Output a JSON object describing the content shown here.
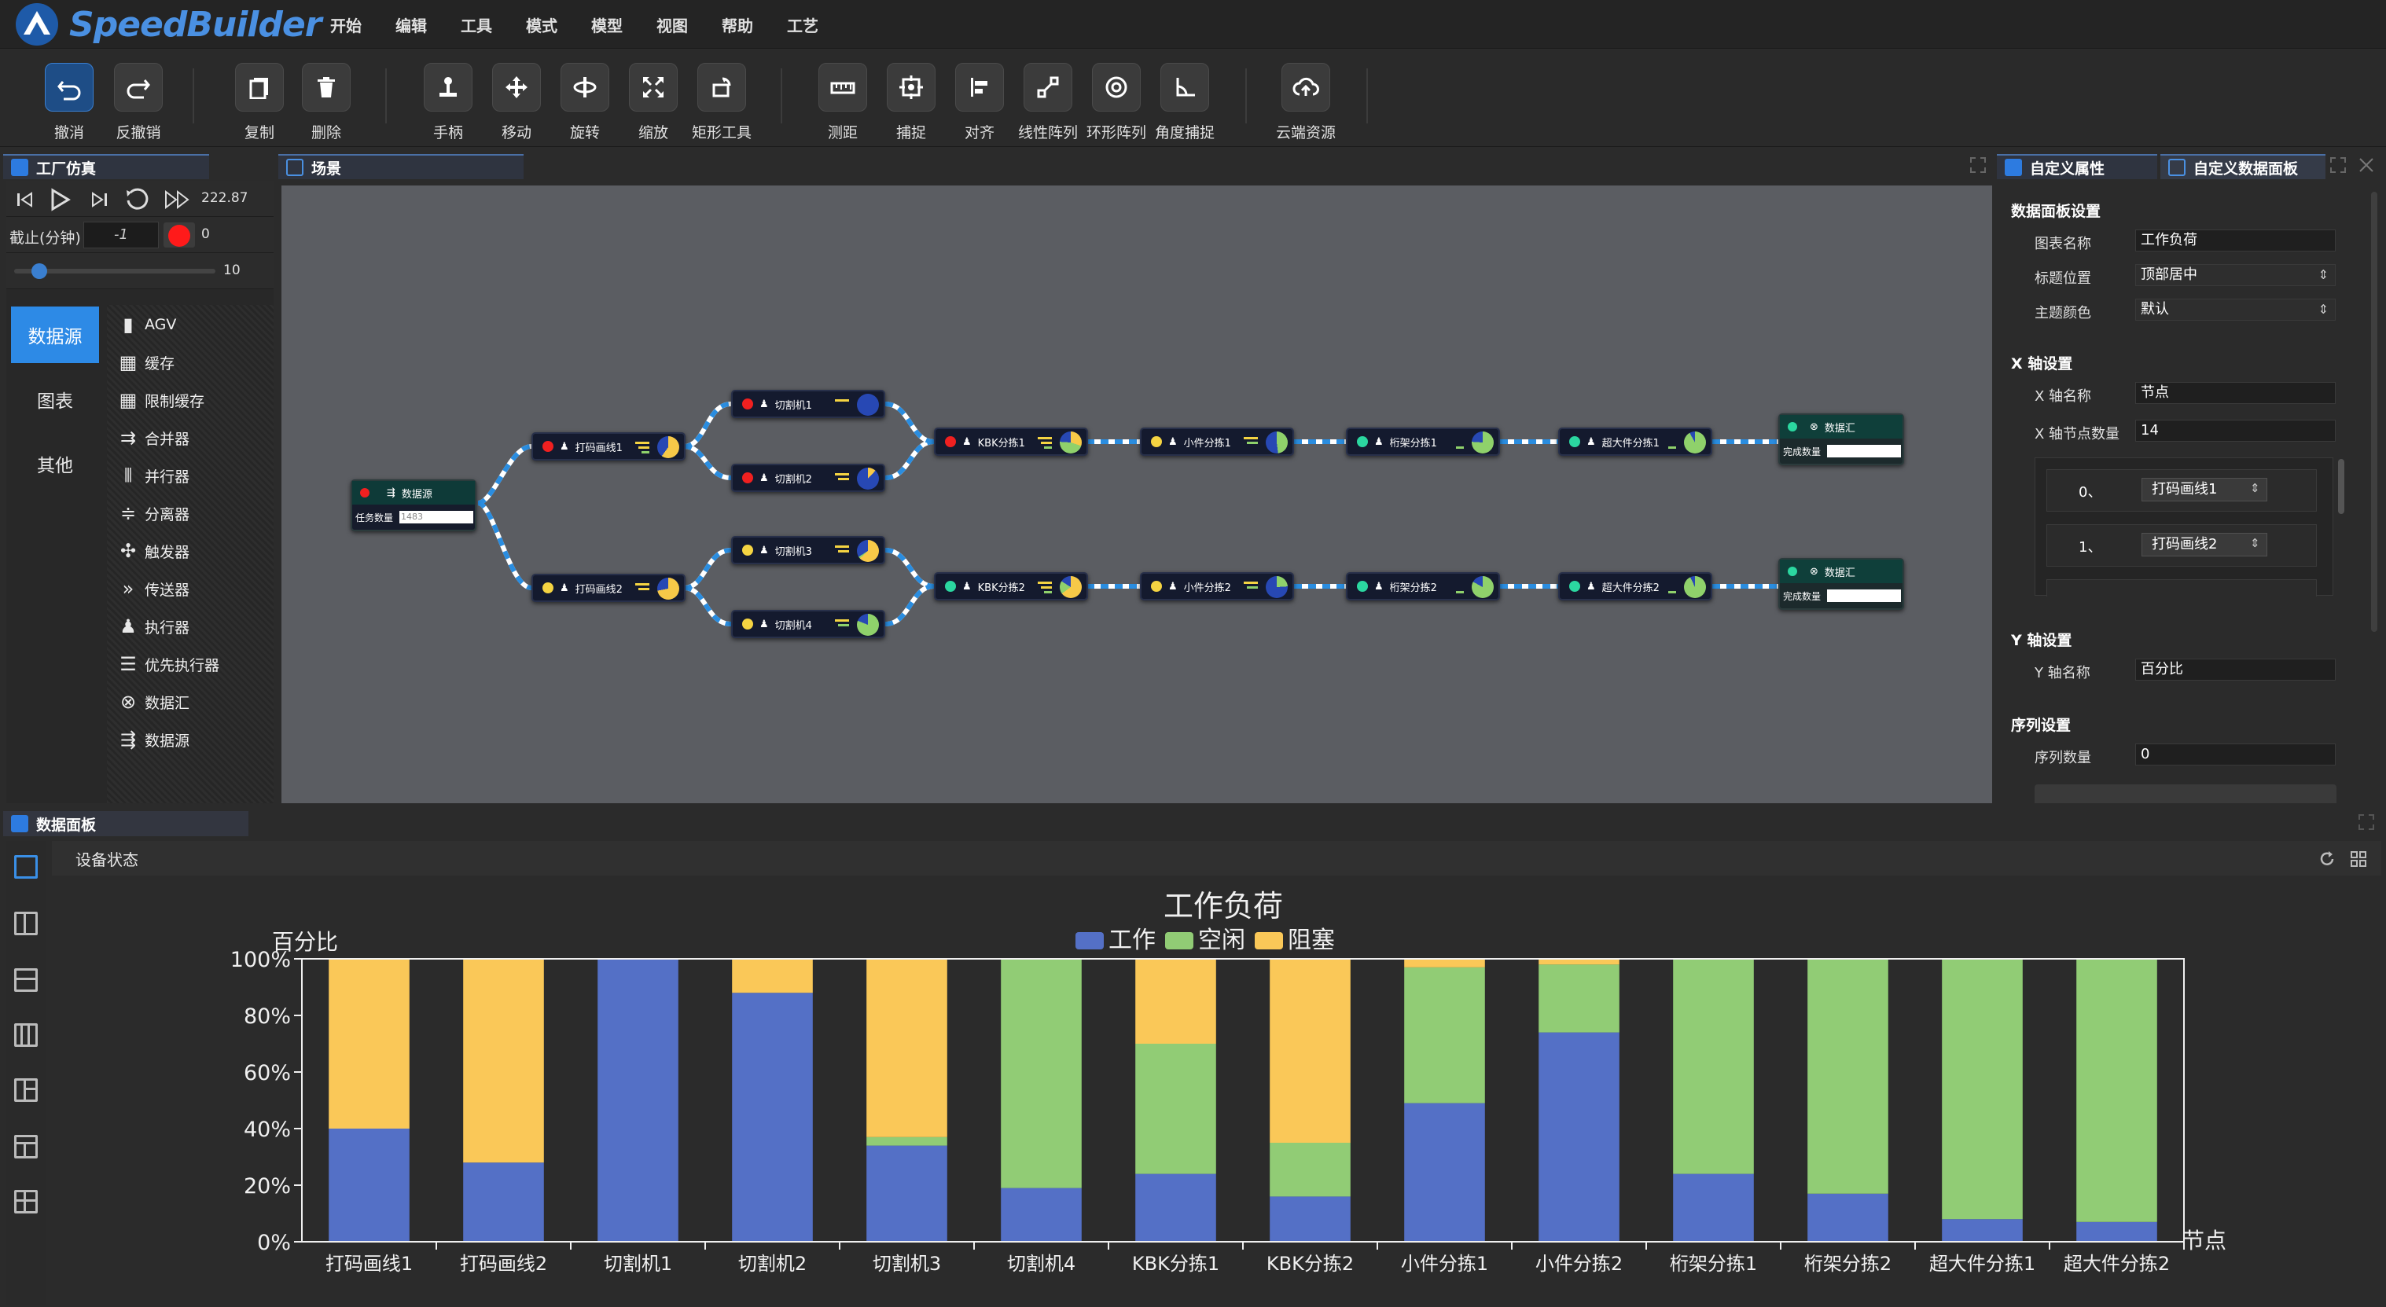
{
  "app": {
    "name": "SpeedBuilder"
  },
  "menu": [
    "开始",
    "编辑",
    "工具",
    "模式",
    "模型",
    "视图",
    "帮助",
    "工艺"
  ],
  "toolbar": [
    {
      "label": "撤消",
      "icon": "undo-icon"
    },
    {
      "label": "反撤销",
      "icon": "redo-icon"
    },
    {
      "label": "复制",
      "icon": "copy-icon"
    },
    {
      "label": "删除",
      "icon": "delete-icon"
    },
    {
      "label": "手柄",
      "icon": "handle-icon"
    },
    {
      "label": "移动",
      "icon": "move-icon"
    },
    {
      "label": "旋转",
      "icon": "rotate-icon"
    },
    {
      "label": "缩放",
      "icon": "scale-icon"
    },
    {
      "label": "矩形工具",
      "icon": "rect-tool-icon"
    },
    {
      "label": "测距",
      "icon": "ruler-icon"
    },
    {
      "label": "捕捉",
      "icon": "snap-icon"
    },
    {
      "label": "对齐",
      "icon": "align-icon"
    },
    {
      "label": "线性阵列",
      "icon": "linear-array-icon"
    },
    {
      "label": "环形阵列",
      "icon": "circular-array-icon"
    },
    {
      "label": "角度捕捉",
      "icon": "angle-snap-icon"
    },
    {
      "label": "云端资源",
      "icon": "cloud-icon"
    }
  ],
  "factory": {
    "title": "工厂仿真",
    "time": "222.87",
    "stop_label": "截止(分钟)",
    "stop_value": "-1",
    "record_count": "0",
    "speed_value": "10",
    "categories": [
      "数据源",
      "图表",
      "其他"
    ],
    "library": [
      "AGV",
      "缓存",
      "限制缓存",
      "合并器",
      "并行器",
      "分离器",
      "触发器",
      "传送器",
      "执行器",
      "优先执行器",
      "数据汇",
      "数据源"
    ]
  },
  "scene": {
    "title": "场景",
    "source": {
      "name": "数据源",
      "field_label": "任务数量",
      "field_value": "1483"
    },
    "nodes": [
      "打码画线1",
      "打码画线2",
      "切割机1",
      "切割机2",
      "切割机3",
      "切割机4",
      "KBK分拣1",
      "KBK分拣2",
      "小件分拣1",
      "小件分拣2",
      "桁架分拣1",
      "桁架分拣2",
      "超大件分拣1",
      "超大件分拣2"
    ],
    "sinks": [
      {
        "name": "数据汇",
        "field_label": "完成数量"
      },
      {
        "name": "数据汇",
        "field_label": "完成数量"
      }
    ]
  },
  "right_panel": {
    "tabs": [
      "自定义属性",
      "自定义数据面板"
    ],
    "data_section": "数据面板设置",
    "chart_name_label": "图表名称",
    "chart_name": "工作负荷",
    "title_pos_label": "标题位置",
    "title_pos": "顶部居中",
    "theme_label": "主题颜色",
    "theme": "默认",
    "x_section": "X 轴设置",
    "x_name_label": "X 轴名称",
    "x_name": "节点",
    "x_count_label": "X 轴节点数量",
    "x_count": "14",
    "x_items": [
      {
        "idx": "0、",
        "val": "打码画线1"
      },
      {
        "idx": "1、",
        "val": "打码画线2"
      }
    ],
    "y_section": "Y 轴设置",
    "y_name_label": "Y 轴名称",
    "y_name": "百分比",
    "series_section": "序列设置",
    "series_count_label": "序列数量",
    "series_count": "0"
  },
  "data_panel": {
    "title": "数据面板",
    "subtitle": "设备状态"
  },
  "colors": {
    "work": "#5470c6",
    "idle": "#91cc75",
    "blocked": "#fac858",
    "accent": "#2d8ae6"
  },
  "chart_data": {
    "type": "bar",
    "stacked": true,
    "title": "工作负荷",
    "xlabel": "节点",
    "ylabel": "百分比",
    "ylim": [
      0,
      100
    ],
    "yticks": [
      "0%",
      "20%",
      "40%",
      "60%",
      "80%",
      "100%"
    ],
    "legend_position": "top-center",
    "categories": [
      "打码画线1",
      "打码画线2",
      "切割机1",
      "切割机2",
      "切割机3",
      "切割机4",
      "KBK分拣1",
      "KBK分拣2",
      "小件分拣1",
      "小件分拣2",
      "桁架分拣1",
      "桁架分拣2",
      "超大件分拣1",
      "超大件分拣2"
    ],
    "series": [
      {
        "name": "工作",
        "values": [
          40,
          28,
          100,
          88,
          34,
          19,
          24,
          16,
          49,
          74,
          24,
          17,
          8,
          7
        ]
      },
      {
        "name": "空闲",
        "values": [
          0,
          0,
          0,
          0,
          3,
          81,
          46,
          19,
          48,
          24,
          76,
          83,
          92,
          93
        ]
      },
      {
        "name": "阻塞",
        "values": [
          60,
          72,
          0,
          12,
          63,
          0,
          30,
          65,
          3,
          2,
          0,
          0,
          0,
          0
        ]
      }
    ]
  }
}
